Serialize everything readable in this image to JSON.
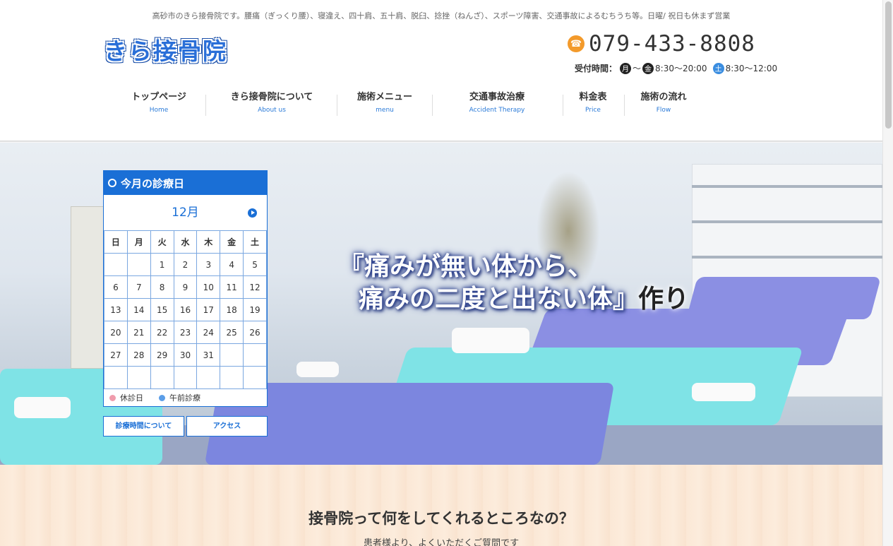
{
  "header": {
    "tagline": "高砂市のきら接骨院です。腰痛（ぎっくり腰）、寝違え、四十肩、五十肩、脱臼、捻挫（ねんざ）、スポーツ障害、交通事故によるむちうち等。日曜/ 祝日も休まず営業",
    "logo_chars": [
      "き",
      "ら",
      "接",
      "骨",
      "院"
    ],
    "phone": "079-433-8808",
    "hours_label": "受付時間：",
    "hours_mon": "月",
    "hours_tilde": "〜",
    "hours_fri": "金",
    "hours_weekday": "8:30〜20:00",
    "hours_sat": "土",
    "hours_saturday": "8:30〜12:00"
  },
  "nav": [
    {
      "jp": "トップページ",
      "en": "Home"
    },
    {
      "jp": "きら接骨院について",
      "en": "About us"
    },
    {
      "jp": "施術メニュー",
      "en": "menu"
    },
    {
      "jp": "交通事故治療",
      "en": "Accident Therapy"
    },
    {
      "jp": "料金表",
      "en": "Price"
    },
    {
      "jp": "施術の流れ",
      "en": "Flow"
    }
  ],
  "hero": {
    "line1": "『痛みが無い体から、",
    "line2": "痛みの二度と出ない体』",
    "line2_tail": "作り"
  },
  "calendar": {
    "title": "今月の診療日",
    "month": "12月",
    "weekdays": [
      "日",
      "月",
      "火",
      "水",
      "木",
      "金",
      "土"
    ],
    "weeks": [
      [
        "",
        "",
        "1",
        "2",
        "3",
        "4",
        "5"
      ],
      [
        "6",
        "7",
        "8",
        "9",
        "10",
        "11",
        "12"
      ],
      [
        "13",
        "14",
        "15",
        "16",
        "17",
        "18",
        "19"
      ],
      [
        "20",
        "21",
        "22",
        "23",
        "24",
        "25",
        "26"
      ],
      [
        "27",
        "28",
        "29",
        "30",
        "31",
        "",
        ""
      ],
      [
        "",
        "",
        "",
        "",
        "",
        "",
        ""
      ]
    ],
    "legend_closed": "休診日",
    "legend_morning": "午前診療",
    "btn_hours": "診療時間について",
    "btn_access": "アクセス",
    "colors": {
      "primary": "#1a6fd6",
      "closed": "#f09cac",
      "morning": "#5b9ee8"
    }
  },
  "faq": {
    "title": "接骨院って何をしてくれるところなの？",
    "subtitle": "患者様より、よくいただくご質問です"
  }
}
